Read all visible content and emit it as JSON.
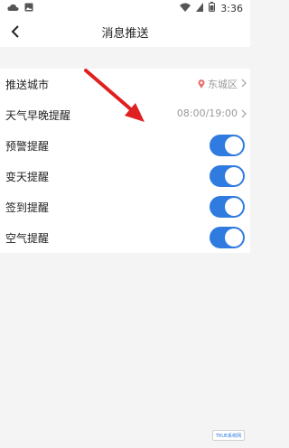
{
  "status_bar": {
    "time": "3:36"
  },
  "nav": {
    "title": "消息推送"
  },
  "rows": [
    {
      "label": "推送城市",
      "value": "东城区"
    },
    {
      "label": "天气早晚提醒",
      "value": "08:00/19:00"
    },
    {
      "label": "预警提醒",
      "on": true
    },
    {
      "label": "变天提醒",
      "on": true
    },
    {
      "label": "签到提醒",
      "on": true
    },
    {
      "label": "空气提醒",
      "on": true
    }
  ],
  "colors": {
    "accent": "#2f7be0",
    "annotation_arrow": "#e02020"
  },
  "watermark": {
    "text": "TRUE 系统网"
  }
}
